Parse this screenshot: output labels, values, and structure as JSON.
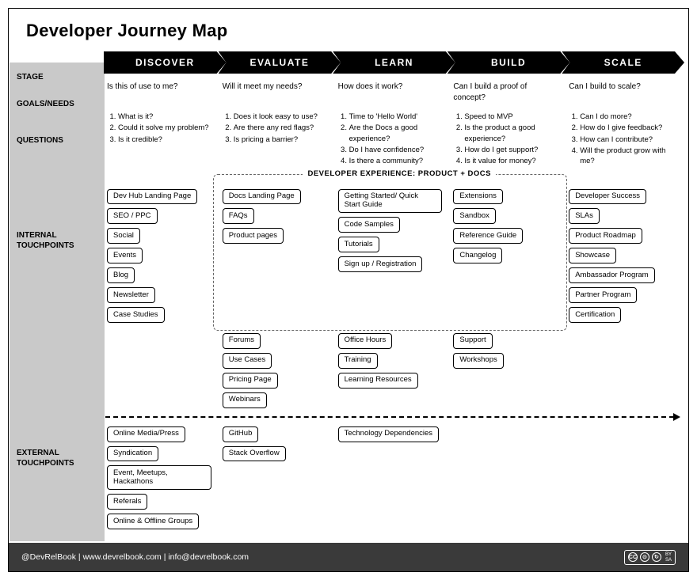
{
  "title": "Developer Journey Map",
  "labels": {
    "stage": "STAGE",
    "goals": "GOALS/NEEDS",
    "questions": "QUESTIONS",
    "internal": "INTERNAL TOUCHPOINTS",
    "external": "EXTERNAL TOUCHPOINTS"
  },
  "devexp_label": "DEVELOPER EXPERIENCE: PRODUCT + DOCS",
  "stages": [
    {
      "name": "DISCOVER",
      "goal": "Is this of use to me?",
      "questions": [
        "What is it?",
        "Could it solve my problem?",
        "Is it credible?"
      ],
      "internal_in_box": [],
      "internal_out": [
        "Dev Hub Landing Page",
        "SEO / PPC",
        "Social",
        "Events",
        "Blog",
        "Newsletter",
        "Case Studies"
      ],
      "external": [
        "Online Media/Press",
        "Syndication",
        "Event, Meetups, Hackathons",
        "Referals",
        "Online & Offline Groups"
      ]
    },
    {
      "name": "EVALUATE",
      "goal": "Will it meet my needs?",
      "questions": [
        "Does it look easy to use?",
        "Are there any red flags?",
        "Is pricing a barrier?"
      ],
      "internal_in_box": [
        "Docs Landing Page",
        "FAQs",
        "Product pages"
      ],
      "internal_out": [
        "Forums",
        "Use Cases",
        "Pricing Page",
        "Webinars"
      ],
      "external": [
        "GitHub",
        "Stack Overflow"
      ]
    },
    {
      "name": "LEARN",
      "goal": "How does it work?",
      "questions": [
        "Time to 'Hello World'",
        "Are the Docs a good experience?",
        "Do I have confidence?",
        "Is there a community?"
      ],
      "internal_in_box": [
        "Getting Started/ Quick Start Guide",
        "Code Samples",
        "Tutorials",
        "Sign up / Registration"
      ],
      "internal_out": [
        "Office Hours",
        "Training",
        "Learning Resources"
      ],
      "external": [
        "Technology Dependencies"
      ]
    },
    {
      "name": "BUILD",
      "goal": "Can I build a proof of concept?",
      "questions": [
        "Speed to MVP",
        "Is the product a good experience?",
        "How do I get support?",
        "Is it value for money?"
      ],
      "internal_in_box": [
        "Extensions",
        "Sandbox",
        "Reference Guide",
        "Changelog"
      ],
      "internal_out": [
        "Support",
        "Workshops"
      ],
      "external": []
    },
    {
      "name": "SCALE",
      "goal": "Can I build to scale?",
      "questions": [
        "Can I do more?",
        "How do I give feedback?",
        "How can I contribute?",
        "Will the product grow with me?"
      ],
      "internal_in_box": [],
      "internal_out": [
        "Developer Success",
        "SLAs",
        "Product Roadmap",
        "Showcase",
        "Ambassador Program",
        "Partner Program",
        "Certification"
      ],
      "external": []
    }
  ],
  "footer": {
    "text": "@DevRelBook  |  www.devrelbook.com  |  info@devrelbook.com",
    "cc_label": "CC",
    "by": "BY",
    "sa": "SA"
  }
}
